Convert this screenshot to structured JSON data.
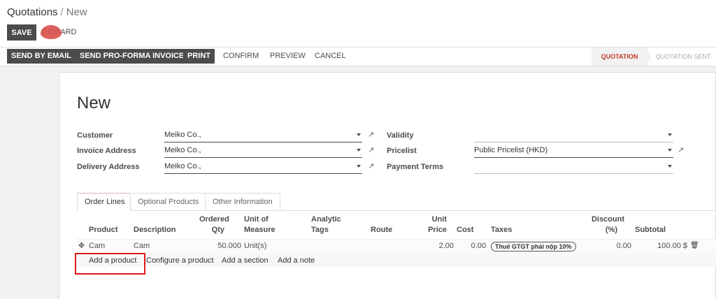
{
  "breadcrumb": {
    "parent": "Quotations",
    "separator": "/",
    "current": "New"
  },
  "control": {
    "save_label": "SAVE",
    "discard_label": "DISCARD"
  },
  "actions": {
    "send_email": "SEND BY EMAIL",
    "send_proforma": "SEND PRO-FORMA INVOICE",
    "print": "PRINT",
    "confirm": "CONFIRM",
    "preview": "PREVIEW",
    "cancel": "CANCEL"
  },
  "stages": {
    "active": "QUOTATION",
    "next": "QUOTATION SENT"
  },
  "form": {
    "title": "New",
    "customer_label": "Customer",
    "customer_value": "Meiko Co.,",
    "invoice_address_label": "Invoice Address",
    "invoice_address_value": "Meiko Co.,",
    "delivery_address_label": "Delivery Address",
    "delivery_address_value": "Meiko Co.,",
    "validity_label": "Validity",
    "validity_value": "",
    "pricelist_label": "Pricelist",
    "pricelist_value": "Public Pricelist (HKD)",
    "payment_terms_label": "Payment Terms",
    "payment_terms_value": ""
  },
  "tabs": [
    "Order Lines",
    "Optional Products",
    "Other Information"
  ],
  "table": {
    "headers": {
      "product": "Product",
      "description": "Description",
      "ordered_qty_1": "Ordered",
      "ordered_qty_2": "Qty",
      "uom_1": "Unit of",
      "uom_2": "Measure",
      "analytic_1": "Analytic",
      "analytic_2": "Tags",
      "route": "Route",
      "unit_price_1": "Unit",
      "unit_price_2": "Price",
      "cost": "Cost",
      "taxes": "Taxes",
      "discount_1": "Discount",
      "discount_2": "(%)",
      "subtotal": "Subtotal"
    },
    "row": {
      "product": "Cam",
      "description": "Cam",
      "qty": "50.000",
      "uom": "Unit(s)",
      "unit_price": "2.00",
      "cost": "0.00",
      "tax": "Thuế GTGT phải nộp 10%",
      "discount": "0.00",
      "subtotal": "100.00 $"
    },
    "add_product": "Add a product",
    "configure_product": "Configure a product",
    "add_section": "Add a section",
    "add_note": "Add a note"
  }
}
